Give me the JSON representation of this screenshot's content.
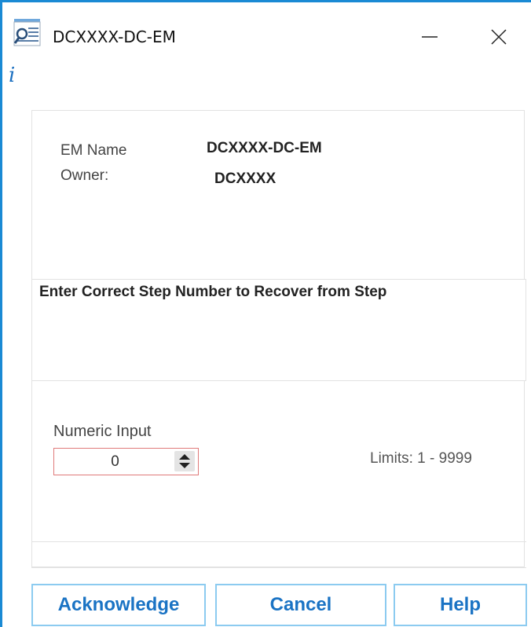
{
  "window": {
    "title": "DCXXXX-DC-EM",
    "info_glyph": "i",
    "icons": [
      "app-search-icon",
      "minimize-icon",
      "close-icon",
      "info-icon"
    ]
  },
  "details": {
    "em_name_label": "EM Name",
    "em_name_value": "DCXXXX-DC-EM",
    "owner_label": "Owner:",
    "owner_value": "DCXXXX"
  },
  "message": "Enter Correct Step Number to Recover from Step",
  "numeric": {
    "label": "Numeric Input",
    "value": "0",
    "limits": "Limits: 1 - 9999"
  },
  "buttons": {
    "acknowledge": "Acknowledge",
    "cancel": "Cancel",
    "help": "Help"
  },
  "colors": {
    "accent": "#1a8ad4",
    "button_text": "#1a73c4",
    "button_border": "#8ccbf0",
    "input_border": "#e07a7a"
  }
}
